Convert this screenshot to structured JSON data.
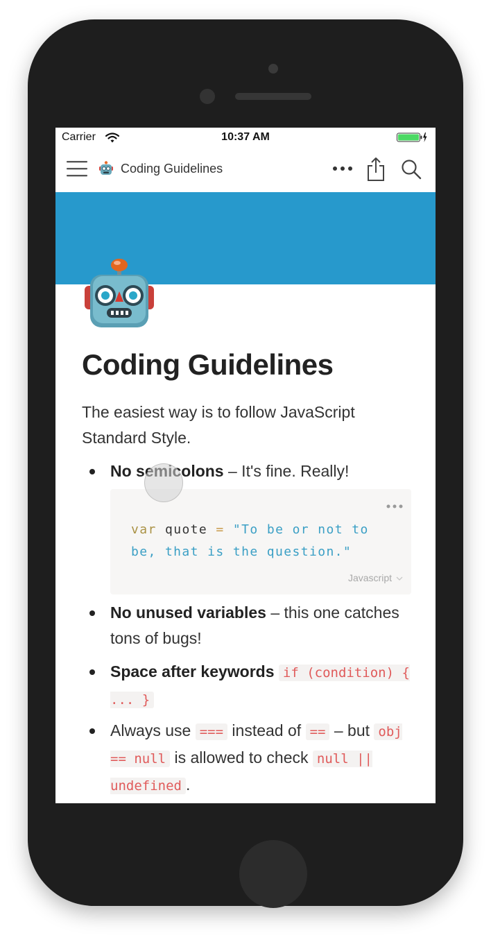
{
  "status_bar": {
    "carrier": "Carrier",
    "time": "10:37 AM",
    "battery_color": "#4cd964"
  },
  "nav": {
    "title": "Coding Guidelines",
    "icons": [
      "menu-icon",
      "robot-icon",
      "more-icon",
      "share-icon",
      "search-icon"
    ]
  },
  "cover_color": "#2799cc",
  "page": {
    "icon": "robot-icon",
    "title": "Coding Guidelines",
    "intro": "The easiest way is to follow JavaScript Standard Style."
  },
  "bullets": [
    {
      "bold": "No semicolons",
      "text": " – It's fine. Really!"
    },
    {
      "bold": "No unused variables",
      "text": " – this one catches tons of bugs!"
    },
    {
      "bold": "Space after keywords",
      "code": "if (condition) { ... }"
    },
    {
      "text1": "Always use ",
      "code1": "===",
      "text2": " instead of ",
      "code2": "==",
      "text3": " – but ",
      "code3": "obj == null",
      "text4": " is allowed to check ",
      "code4": "null || undefined",
      "text5": "."
    }
  ],
  "code_block": {
    "keyword": "var",
    "identifier": "quote",
    "operator": "=",
    "string_line1": "\"To be or not to",
    "string_line2": "be, that is the question.\"",
    "language": "Javascript"
  }
}
